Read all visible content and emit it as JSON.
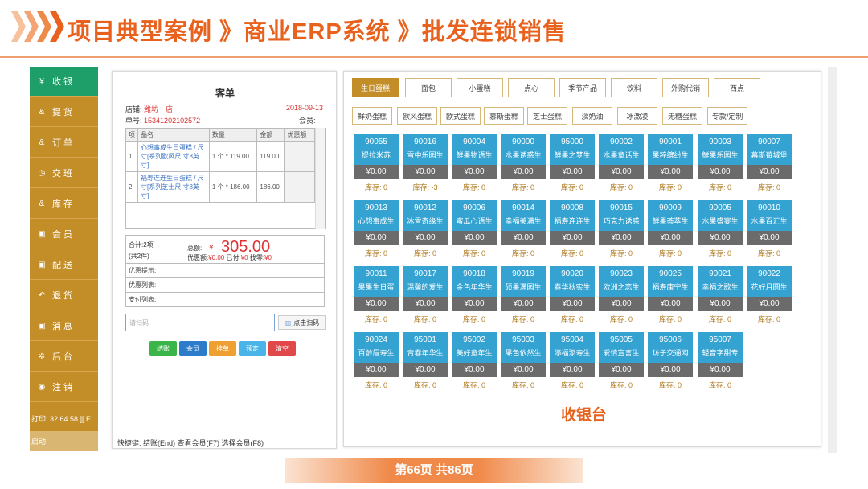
{
  "header": {
    "title": "项目典型案例 》商业ERP系统 》批发连锁销售",
    "accent": "#e8611d"
  },
  "nav": {
    "items": [
      {
        "icon": "yen-icon",
        "glyph": "¥",
        "label": "收 银",
        "active": true
      },
      {
        "icon": "users-icon",
        "glyph": "&",
        "label": "提 货"
      },
      {
        "icon": "users-icon",
        "glyph": "&",
        "label": "订 单"
      },
      {
        "icon": "clock-icon",
        "glyph": "◷",
        "label": "交 班"
      },
      {
        "icon": "users-icon",
        "glyph": "&",
        "label": "库 存"
      },
      {
        "icon": "card-icon",
        "glyph": "▣",
        "label": "会 员"
      },
      {
        "icon": "card-icon",
        "glyph": "▣",
        "label": "配 送"
      },
      {
        "icon": "undo-icon",
        "glyph": "↶",
        "label": "退 货"
      },
      {
        "icon": "card-icon",
        "glyph": "▣",
        "label": "消 息"
      },
      {
        "icon": "gear-icon",
        "glyph": "✲",
        "label": "后 台"
      },
      {
        "icon": "power-icon",
        "glyph": "◉",
        "label": "注 销"
      }
    ],
    "footer_print": "打印: 32 64 58 ][ E",
    "footer_status": "启动"
  },
  "order": {
    "title": "客单",
    "store_label": "店铺:",
    "store_name": "潍坊一店",
    "date": "2018-09-13",
    "order_no_label": "单号:",
    "order_no": "15341202102572",
    "member_label": "会员:",
    "columns": [
      "项",
      "品名",
      "数量",
      "金额",
      "优惠额"
    ],
    "rows": [
      {
        "idx": "1",
        "name": "心想事成生日蛋糕 / 尺寸[系列欧风尺 寸8英寸]",
        "qty": "1 个 * 119.00",
        "amount": "119.00",
        "discount": ""
      },
      {
        "idx": "2",
        "name": "福寿连连生日蛋糕 / 尺寸[系列芝士尺 寸8英寸]",
        "qty": "1 个 * 186.00",
        "amount": "186.00",
        "discount": ""
      }
    ],
    "summary": {
      "subtotal_label": "合计:2项",
      "pieces_label": "(共2件)",
      "total_label": "总额:",
      "total_currency": "¥",
      "total_value": "305.00",
      "discount_label": "优惠额:",
      "discount_value": "¥0.00",
      "paid_label": "已付:",
      "paid_value": "¥0",
      "change_label": "找零:",
      "change_value": "¥0",
      "promo_hint": "优惠提示:",
      "promo_list": "优惠列表:",
      "pay_list": "支付列表:"
    },
    "scan_placeholder": "请扫码",
    "scan_button": "点击扫码",
    "actions": [
      {
        "label": "结账",
        "color": "#3bb54a"
      },
      {
        "label": "会员",
        "color": "#2d7ccc"
      },
      {
        "label": "挂单",
        "color": "#f0a030"
      },
      {
        "label": "预定",
        "color": "#4ab3e8"
      },
      {
        "label": "清空",
        "color": "#e0484a"
      }
    ],
    "shortcuts": "快捷键: 结账(End)  查看会员(F7)  选择会员(F8)"
  },
  "products": {
    "categories": [
      "生日蛋糕",
      "面包",
      "小蛋糕",
      "点心",
      "季节产品",
      "饮料",
      "外购代销",
      "西点"
    ],
    "active_category": 0,
    "subcategories": [
      "鲜奶蛋糕",
      "欧风蛋糕",
      "欧式蛋糕",
      "慕斯蛋糕",
      "芝士蛋糕",
      "淡奶油",
      "冰激凌",
      "无糖蛋糕",
      "专款/定制"
    ],
    "items": [
      {
        "code": "90055",
        "name": "提拉米苏",
        "price": "¥0.00",
        "stock": "库存: 0"
      },
      {
        "code": "90016",
        "name": "雪中乐园生",
        "price": "¥0.00",
        "stock": "库存: -3"
      },
      {
        "code": "90004",
        "name": "鲜果物语生",
        "price": "¥0.00",
        "stock": "库存: 0"
      },
      {
        "code": "90000",
        "name": "水果诱惑生",
        "price": "¥0.00",
        "stock": "库存: 0"
      },
      {
        "code": "95000",
        "name": "鲜果之梦生",
        "price": "¥0.00",
        "stock": "库存: 0"
      },
      {
        "code": "90002",
        "name": "水果童话生",
        "price": "¥0.00",
        "stock": "库存: 0"
      },
      {
        "code": "90001",
        "name": "果粹缤纷生",
        "price": "¥0.00",
        "stock": "库存: 0"
      },
      {
        "code": "90003",
        "name": "鲜果乐园生",
        "price": "¥0.00",
        "stock": "库存: 0"
      },
      {
        "code": "90007",
        "name": "幕斯莓城堡",
        "price": "¥0.00",
        "stock": "库存: 0"
      },
      {
        "code": "90013",
        "name": "心想事成生",
        "price": "¥0.00",
        "stock": "库存: 0"
      },
      {
        "code": "90012",
        "name": "冰雪奇缘生",
        "price": "¥0.00",
        "stock": "库存: 0"
      },
      {
        "code": "90006",
        "name": "蜜瓜心语生",
        "price": "¥0.00",
        "stock": "库存: 0"
      },
      {
        "code": "90014",
        "name": "幸福美满生",
        "price": "¥0.00",
        "stock": "库存: 0"
      },
      {
        "code": "90008",
        "name": "福寿连连生",
        "price": "¥0.00",
        "stock": "库存: 0"
      },
      {
        "code": "90015",
        "name": "巧克力诱惑",
        "price": "¥0.00",
        "stock": "库存: 0"
      },
      {
        "code": "90009",
        "name": "鲜果荟萃生",
        "price": "¥0.00",
        "stock": "库存: 0"
      },
      {
        "code": "90005",
        "name": "水果盛宴生",
        "price": "¥0.00",
        "stock": "库存: 0"
      },
      {
        "code": "90010",
        "name": "水果百汇生",
        "price": "¥0.00",
        "stock": "库存: 0"
      },
      {
        "code": "90011",
        "name": "果果生日蛋",
        "price": "¥0.00",
        "stock": "库存: 0"
      },
      {
        "code": "90017",
        "name": "温馨的爱生",
        "price": "¥0.00",
        "stock": "库存: 0"
      },
      {
        "code": "90018",
        "name": "金色年华生",
        "price": "¥0.00",
        "stock": "库存: 0"
      },
      {
        "code": "90019",
        "name": "硕果满园生",
        "price": "¥0.00",
        "stock": "库存: 0"
      },
      {
        "code": "90020",
        "name": "春华秋实生",
        "price": "¥0.00",
        "stock": "库存: 0"
      },
      {
        "code": "90023",
        "name": "欧洲之恋生",
        "price": "¥0.00",
        "stock": "库存: 0"
      },
      {
        "code": "90025",
        "name": "福寿康宁生",
        "price": "¥0.00",
        "stock": "库存: 0"
      },
      {
        "code": "90021",
        "name": "幸福之歌生",
        "price": "¥0.00",
        "stock": "库存: 0"
      },
      {
        "code": "90022",
        "name": "花好月圆生",
        "price": "¥0.00",
        "stock": "库存: 0"
      },
      {
        "code": "90024",
        "name": "百龄眉寿生",
        "price": "¥0.00",
        "stock": "库存: 0"
      },
      {
        "code": "95001",
        "name": "青春年华生",
        "price": "¥0.00",
        "stock": "库存: 0"
      },
      {
        "code": "95002",
        "name": "美好童年生",
        "price": "¥0.00",
        "stock": "库存: 0"
      },
      {
        "code": "95003",
        "name": "果色依然生",
        "price": "¥0.00",
        "stock": "库存: 0"
      },
      {
        "code": "95004",
        "name": "添福添寿生",
        "price": "¥0.00",
        "stock": "库存: 0"
      },
      {
        "code": "95005",
        "name": "爱情宣言生",
        "price": "¥0.00",
        "stock": "库存: 0"
      },
      {
        "code": "95006",
        "name": "访子交通网",
        "price": "¥0.00",
        "stock": "库存: 0"
      },
      {
        "code": "95007",
        "name": "轻音字甜专",
        "price": "¥0.00",
        "stock": "库存: 0"
      }
    ],
    "cashier_label": "收银台"
  },
  "footer": {
    "page": "第66页  共86页"
  }
}
